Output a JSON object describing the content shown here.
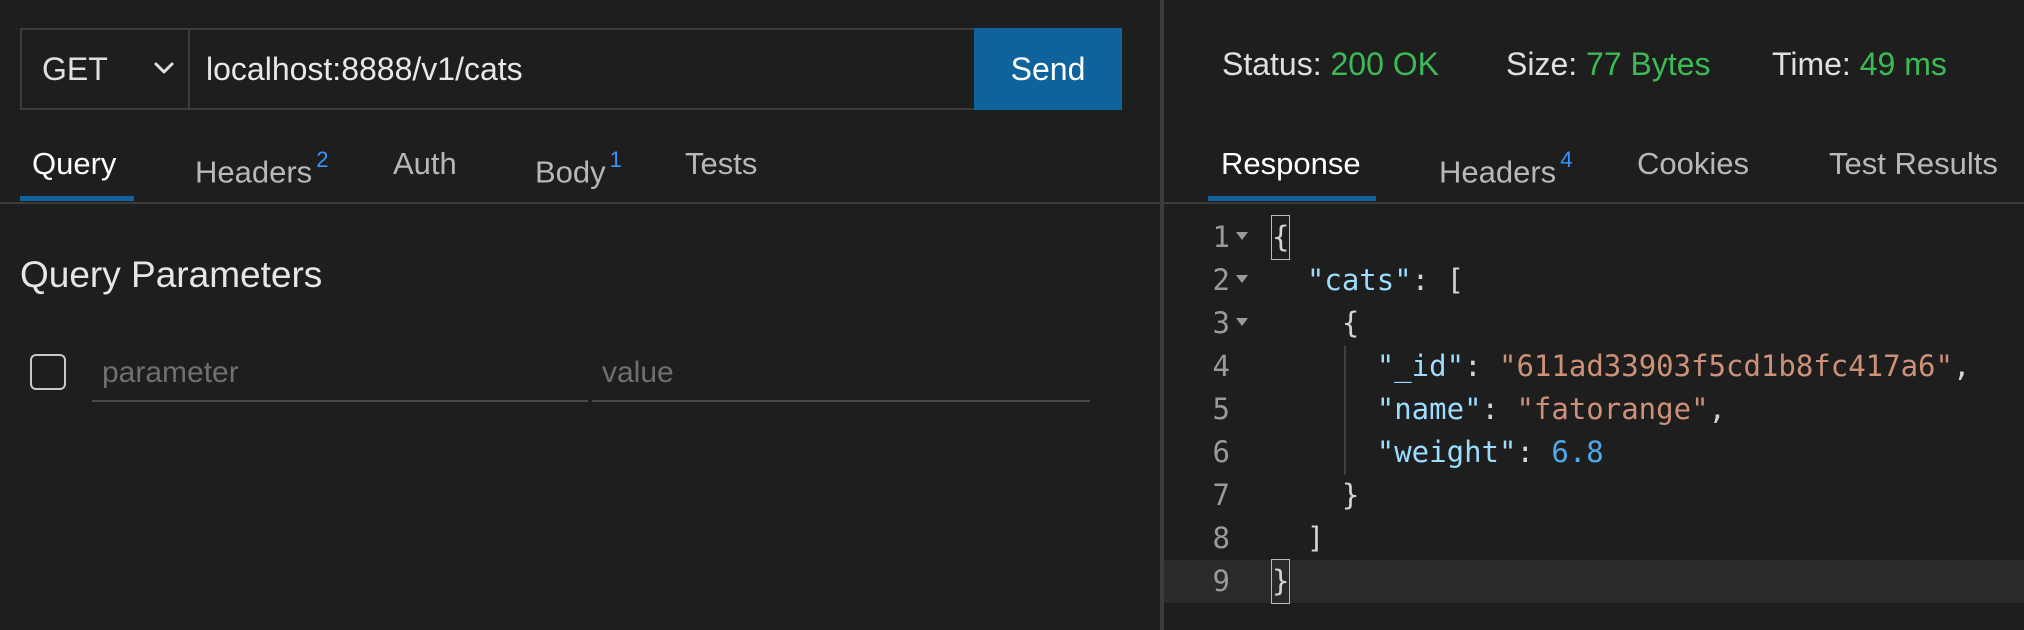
{
  "request": {
    "method": "GET",
    "url": "localhost:8888/v1/cats",
    "send_label": "Send"
  },
  "request_tabs": [
    {
      "label": "Query",
      "badge": ""
    },
    {
      "label": "Headers",
      "badge": "2"
    },
    {
      "label": "Auth",
      "badge": ""
    },
    {
      "label": "Body",
      "badge": "1"
    },
    {
      "label": "Tests",
      "badge": ""
    }
  ],
  "query": {
    "title": "Query Parameters",
    "param_placeholder": "parameter",
    "value_placeholder": "value"
  },
  "status": {
    "status_label": "Status:",
    "status_value": "200 OK",
    "size_label": "Size:",
    "size_value": "77 Bytes",
    "time_label": "Time:",
    "time_value": "49 ms"
  },
  "response_tabs": [
    {
      "label": "Response",
      "badge": ""
    },
    {
      "label": "Headers",
      "badge": "4"
    },
    {
      "label": "Cookies",
      "badge": ""
    },
    {
      "label": "Test Results",
      "badge": ""
    }
  ],
  "response_lines": [
    {
      "n": "1",
      "text": "{"
    },
    {
      "n": "2",
      "text": "  \"cats\": ["
    },
    {
      "n": "3",
      "text": "    {"
    },
    {
      "n": "4",
      "text": "      \"_id\": \"611ad33903f5cd1b8fc417a6\","
    },
    {
      "n": "5",
      "text": "      \"name\": \"fatorange\","
    },
    {
      "n": "6",
      "text": "      \"weight\": 6.8"
    },
    {
      "n": "7",
      "text": "    }"
    },
    {
      "n": "8",
      "text": "  ]"
    },
    {
      "n": "9",
      "text": "}"
    }
  ],
  "colors": {
    "accent": "#0e639c",
    "success": "#3cba54",
    "badge": "#3794ff"
  }
}
